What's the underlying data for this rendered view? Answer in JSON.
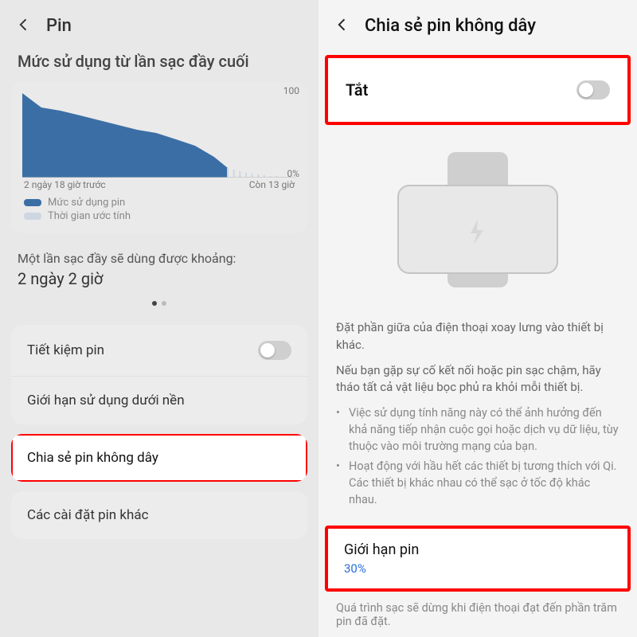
{
  "left": {
    "header_title": "Pin",
    "section_label": "Mức sử dụng từ lần sạc đầy cuối",
    "chart_xlabel_left": "2 ngày 18 giờ trước",
    "chart_xlabel_right": "Còn 13 giờ",
    "chart_y_top": "100",
    "chart_y_bot": "0%",
    "legend_usage": "Mức sử dụng pin",
    "legend_estimate": "Thời gian ước tính",
    "fullcharge_label": "Một lần sạc đầy sẽ dùng được khoảng:",
    "fullcharge_value": "2 ngày 2 giờ",
    "item_saver": "Tiết kiệm pin",
    "item_bg_limit": "Giới hạn sử dụng dưới nền",
    "item_powershare": "Chia sẻ pin không dây",
    "item_more": "Các cài đặt pin khác"
  },
  "right": {
    "header_title": "Chia sẻ pin không dây",
    "toggle_label": "Tắt",
    "desc_p1": "Đặt phần giữa của điện thoại xoay lưng vào thiết bị khác.",
    "desc_p2": "Nếu bạn gặp sự cố kết nối hoặc pin sạc chậm, hãy tháo tất cả vật liệu bọc phủ ra khỏi mỗi thiết bị.",
    "bullet1": "Việc sử dụng tính năng này có thể ảnh hưởng đến khả năng tiếp nhận cuộc gọi hoặc dịch vụ dữ liệu, tùy thuộc vào môi trường mạng của bạn.",
    "bullet2": "Hoạt động với hầu hết các thiết bị tương thích với Qi. Các thiết bị khác nhau có thể sạc ở tốc độ khác nhau.",
    "limit_label": "Giới hạn pin",
    "limit_value": "30%",
    "footer_note": "Quá trình sạc sẽ dừng khi điện thoại đạt đến phần trăm pin đã đặt."
  },
  "chart_data": {
    "type": "area",
    "title": "Mức sử dụng từ lần sạc đầy cuối",
    "xlabel": "",
    "ylabel": "%",
    "ylim": [
      0,
      100
    ],
    "x_range_labels": [
      "2 ngày 18 giờ trước",
      "Còn 13 giờ"
    ],
    "series": [
      {
        "name": "Mức sử dụng pin",
        "color": "#3b6ea5",
        "x": [
          0,
          0.07,
          0.14,
          0.21,
          0.28,
          0.35,
          0.42,
          0.49,
          0.56,
          0.63,
          0.7,
          0.75
        ],
        "values": [
          98,
          82,
          78,
          72,
          66,
          60,
          55,
          50,
          44,
          38,
          24,
          12
        ]
      },
      {
        "name": "Thời gian ước tính",
        "color": "#cdd7e2",
        "x": [
          0.75,
          0.82,
          0.89,
          0.96,
          1.0
        ],
        "values": [
          12,
          8,
          5,
          2,
          0
        ]
      }
    ]
  },
  "colors": {
    "highlight": "#f00",
    "accent": "#2a6fd6",
    "chart_fill": "#3b6ea5"
  }
}
